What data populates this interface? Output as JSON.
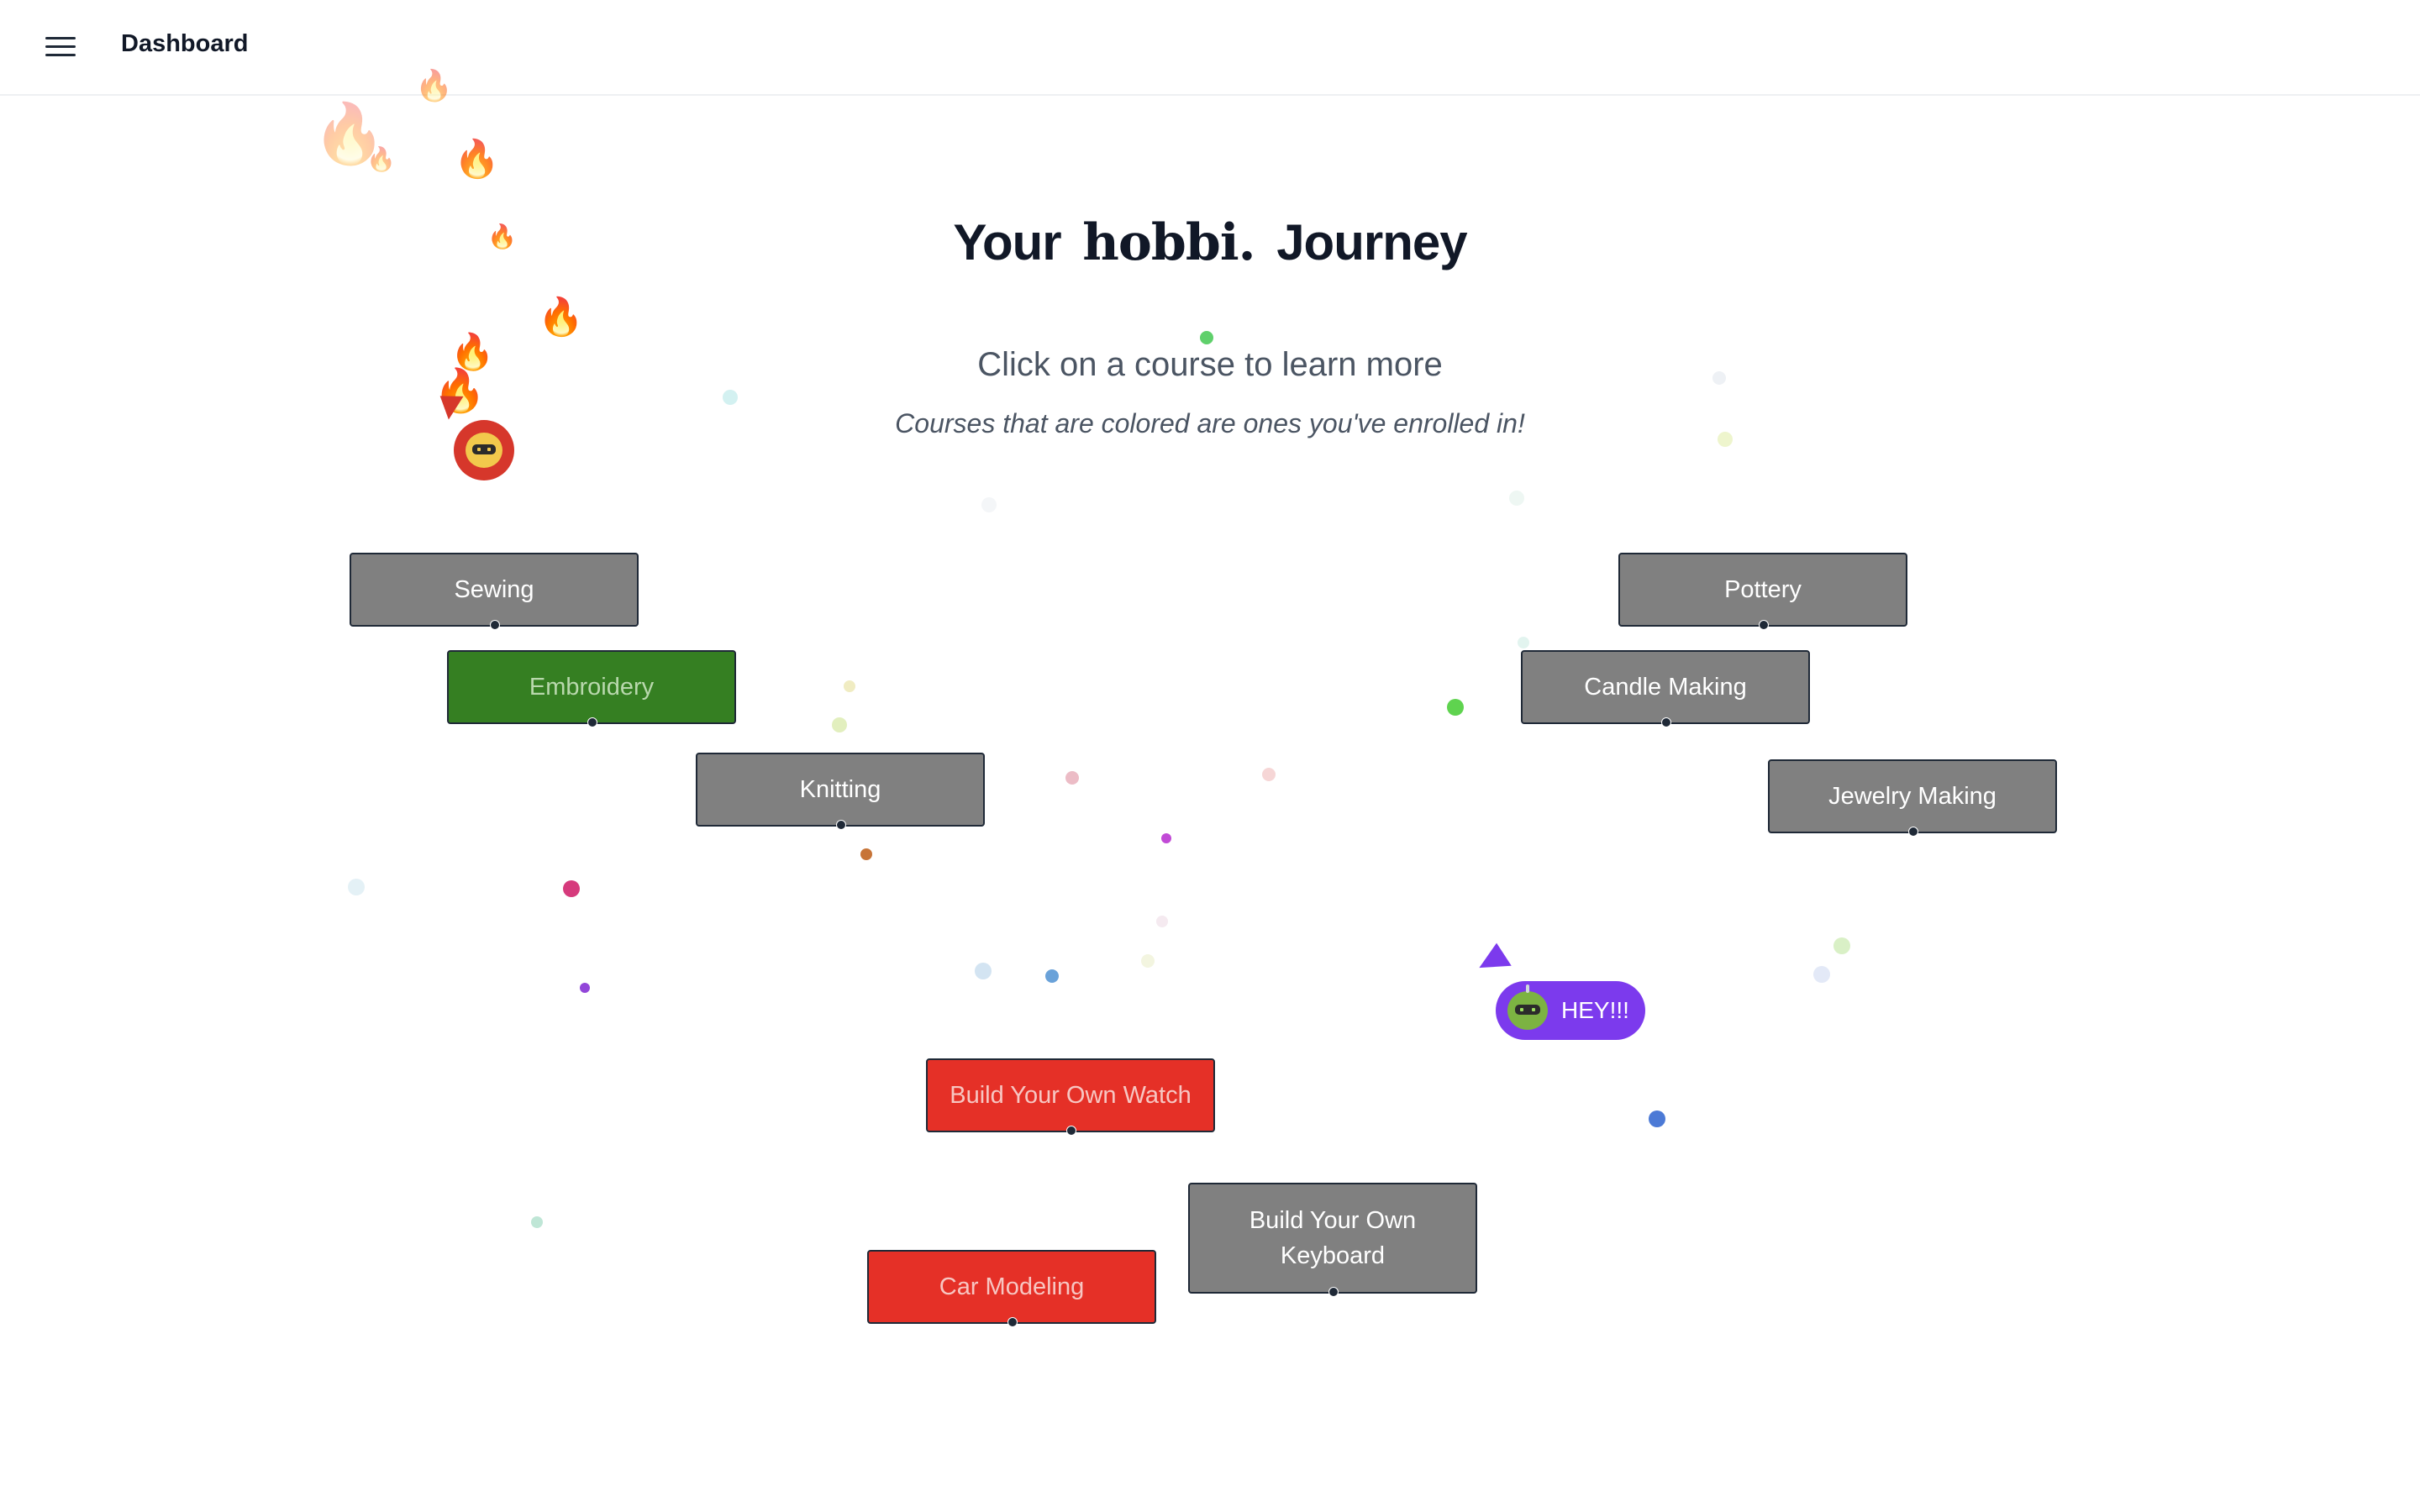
{
  "topbar": {
    "menu_icon": "hamburger-menu-icon",
    "title": "Dashboard"
  },
  "hero": {
    "title_prefix": "Your",
    "brand": "hobbi.",
    "title_suffix": "Journey",
    "subtitle": "Click on a course to learn more",
    "note": "Courses that are colored are ones you've enrolled in!"
  },
  "courses": [
    {
      "label": "Sewing",
      "enrolled": false,
      "color": "#808080"
    },
    {
      "label": "Embroidery",
      "enrolled": true,
      "color": "#357f22"
    },
    {
      "label": "Knitting",
      "enrolled": false,
      "color": "#808080"
    },
    {
      "label": "Pottery",
      "enrolled": false,
      "color": "#808080"
    },
    {
      "label": "Candle Making",
      "enrolled": false,
      "color": "#808080"
    },
    {
      "label": "Jewelry Making",
      "enrolled": false,
      "color": "#808080"
    },
    {
      "label": "Build Your Own Watch",
      "enrolled": true,
      "color": "#e53027"
    },
    {
      "label": "Build Your Own Keyboard",
      "enrolled": false,
      "color": "#808080"
    },
    {
      "label": "Car Modeling",
      "enrolled": true,
      "color": "#e53027"
    }
  ],
  "collaborators": {
    "red_avatar_icon": "robot-avatar-icon",
    "hey_message": "HEY!!!",
    "hey_avatar_icon": "robot-avatar-icon"
  },
  "decorations": {
    "flame_icon": "fire-emoji-icon",
    "confetti": "confetti-dots"
  }
}
